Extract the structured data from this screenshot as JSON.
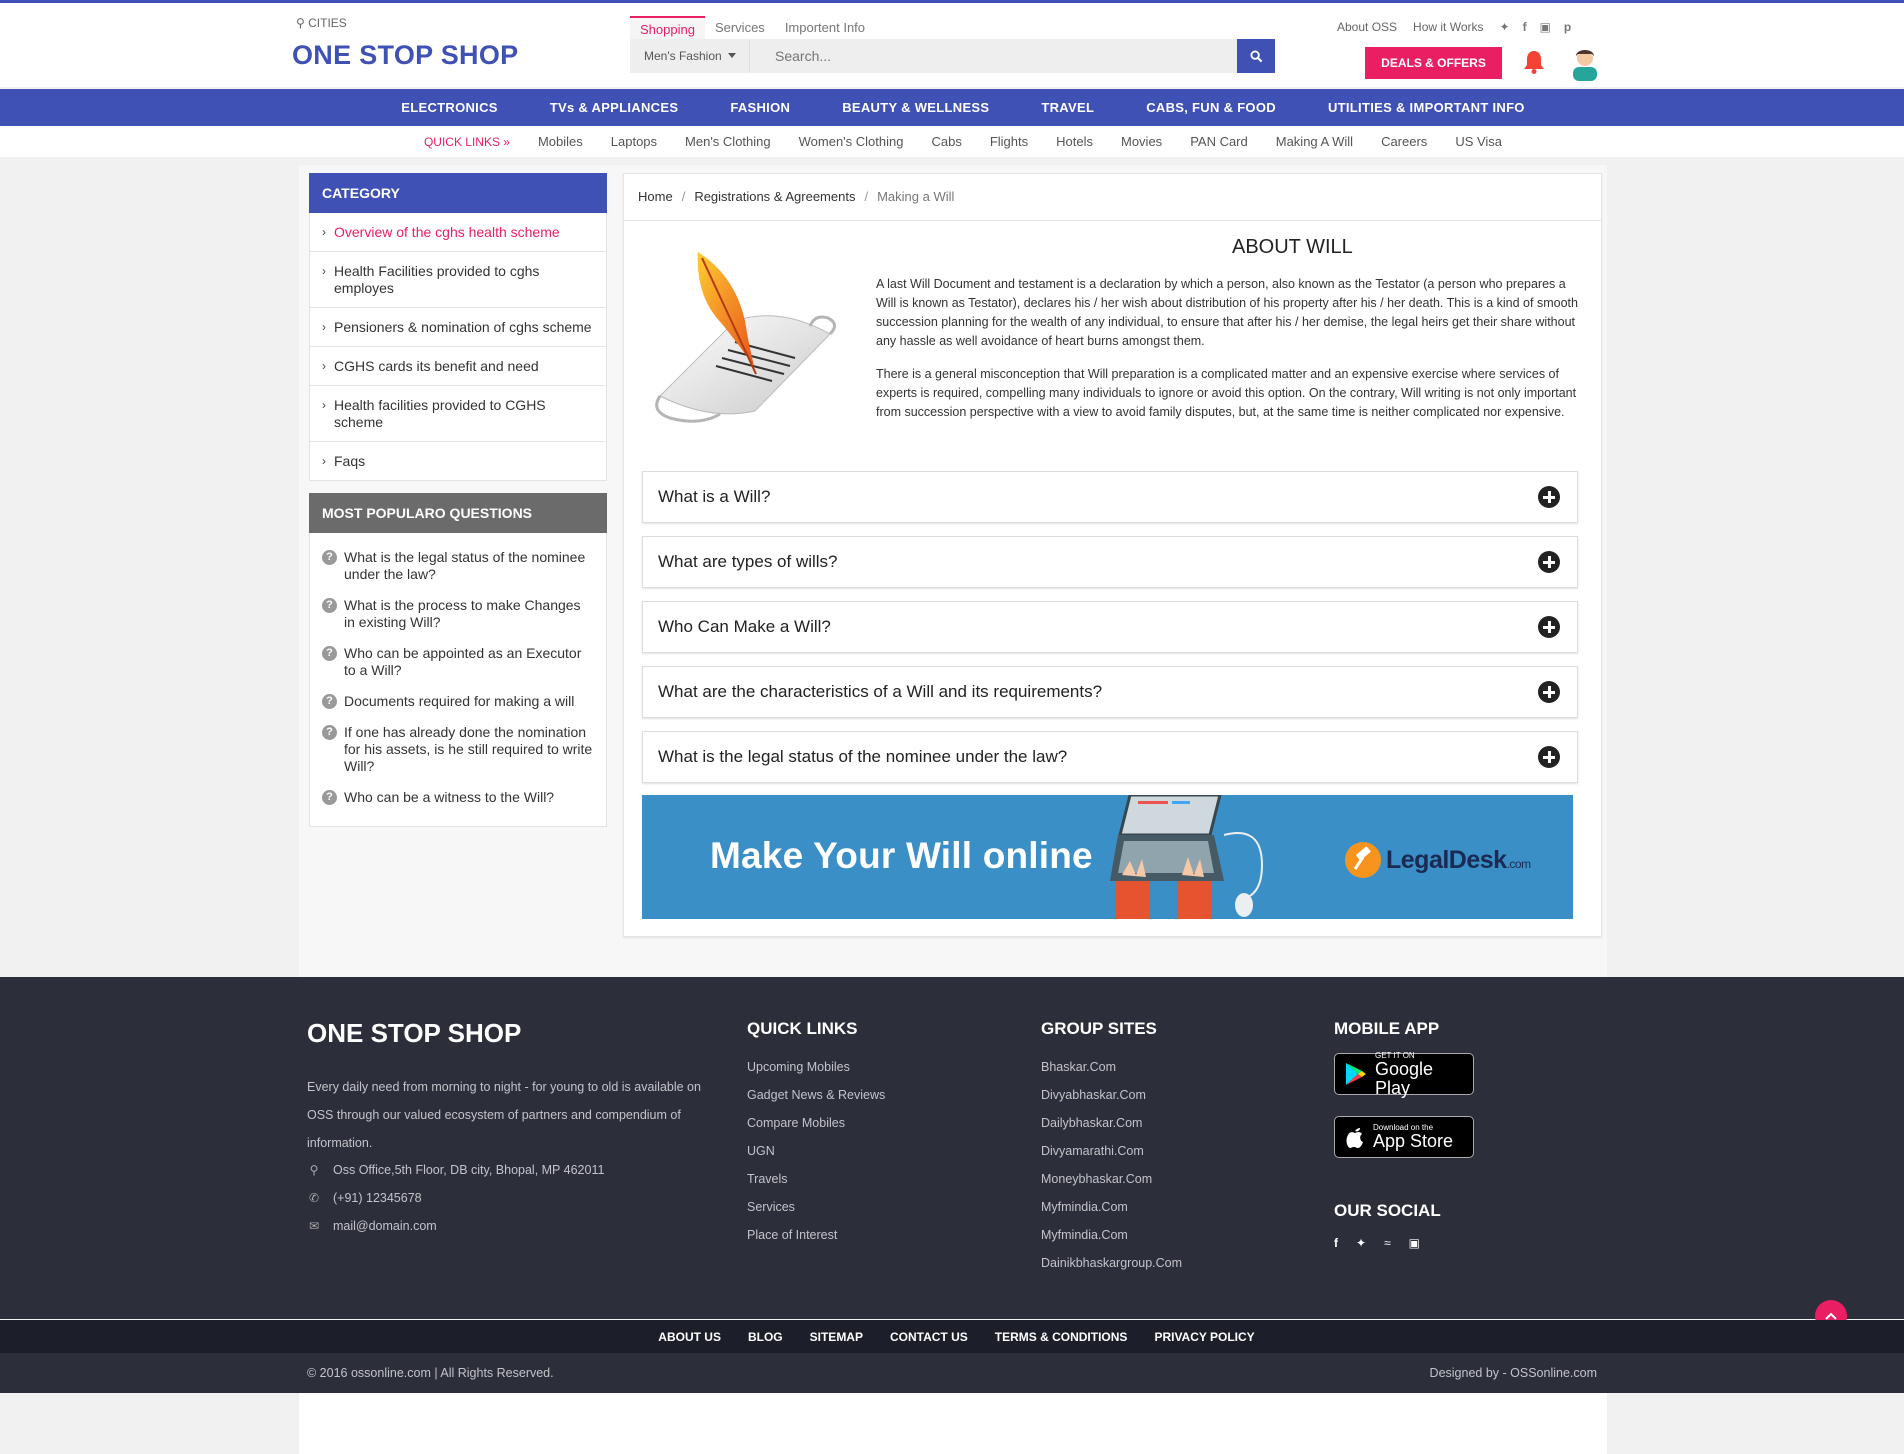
{
  "header": {
    "cities_label": "CITIES",
    "logo": "ONE STOP SHOP",
    "search_tabs": [
      {
        "label": "Shopping"
      },
      {
        "label": "Services"
      },
      {
        "label": "Importent Info"
      }
    ],
    "category_select": "Men's Fashion",
    "search_placeholder": "Search...",
    "top_links": [
      "About OSS",
      "How it Works"
    ],
    "deals_label": "DEALS & OFFERS",
    "accent": "#3f51b5",
    "highlight": "#e91e63"
  },
  "main_nav": [
    "ELECTRONICS",
    "TVs & APPLIANCES",
    "FASHION",
    "BEAUTY & WELLNESS",
    "TRAVEL",
    "CABS, FUN & FOOD",
    "UTILITIES & IMPORTANT INFO"
  ],
  "quick_links": {
    "heading": "QUICK LINKS »",
    "items": [
      "Mobiles",
      "Laptops",
      "Men's Clothing",
      "Women's Clothing",
      "Cabs",
      "Flights",
      "Hotels",
      "Movies",
      "PAN Card",
      "Making A Will",
      "Careers",
      "US Visa"
    ]
  },
  "sidebar": {
    "category_title": "CATEGORY",
    "categories": [
      "Overview of the cghs health scheme",
      "Health Facilities provided to cghs employes",
      "Pensioners & nomination of cghs scheme",
      "CGHS cards its benefit and need",
      "Health facilities provided to CGHS scheme",
      "Faqs"
    ],
    "popular_title": "MOST POPULARO QUESTIONS",
    "popular": [
      "What is the legal status of the nominee under the law?",
      "What is the process to make Changes in existing Will?",
      "Who can be appointed as an Executor to a Will?",
      "Documents required for making a will",
      "If one has already done the nomination for his assets, is he still required to write Will?",
      "Who can be a witness to the Will?"
    ]
  },
  "article": {
    "breadcrumb": [
      "Home",
      "Registrations & Agreements",
      "Making a Will"
    ],
    "title": "ABOUT WILL",
    "paragraph1": "A last Will Document and testament is a declaration by which a person, also known as the Testator (a person who prepares a Will is known as Testator), declares his / her wish about distribution of his property after his / her death. This is a kind of smooth succession planning for the wealth of any individual, to ensure that after his / her demise, the legal heirs get their share without any hassle as well avoidance of heart burns amongst them.",
    "paragraph2": "There is a general misconception that Will preparation is a complicated matter and an expensive exercise where services of experts is required, compelling many individuals to ignore or avoid this option. On the contrary, Will writing is not only important from succession perspective with a view to avoid family disputes, but, at the same time is neither complicated nor expensive.",
    "faqs": [
      "What is a Will?",
      "What are types of wills?",
      "Who Can Make a Will?",
      "What are the characteristics of a Will and its requirements?",
      "What is the legal status of the nominee under the law?"
    ],
    "banner_text": "Make Your Will online",
    "banner_brand": "LegalDesk",
    "banner_brand_suffix": ".com"
  },
  "footer": {
    "brand": "ONE STOP SHOP",
    "description": "Every daily need from morning to night - for young to old is available on OSS through our valued ecosystem of partners and compendium of information.",
    "address": "Oss Office,5th Floor, DB city, Bhopal, MP 462011",
    "phone": "(+91) 12345678",
    "email": "mail@domain.com",
    "quick_links_title": "QUICK LINKS",
    "quick_links": [
      "Upcoming Mobiles",
      "Gadget News & Reviews",
      "Compare Mobiles",
      "UGN",
      "Travels",
      "Services",
      "Place of Interest"
    ],
    "group_sites_title": "GROUP SITES",
    "group_sites": [
      "Bhaskar.Com",
      "Divyabhaskar.Com",
      "Dailybhaskar.Com",
      "Divyamarathi.Com",
      "Moneybhaskar.Com",
      "Myfmindia.Com",
      "Myfmindia.Com",
      "Dainikbhaskargroup.Com"
    ],
    "mobile_app_title": "MOBILE APP",
    "google_play_small": "GET IT ON",
    "google_play_big": "Google Play",
    "app_store_small": "Download on the",
    "app_store_big": "App Store",
    "social_title": "OUR SOCIAL",
    "bottom_links": [
      "ABOUT US",
      "BLOG",
      "SITEMAP",
      "CONTACT US",
      "TERMS & CONDITIONS",
      "PRIVACY POLICY"
    ],
    "copyright": "© 2016 ossonline.com | All Rights Reserved.",
    "designed_by": "Designed by - OSSonline.com"
  }
}
